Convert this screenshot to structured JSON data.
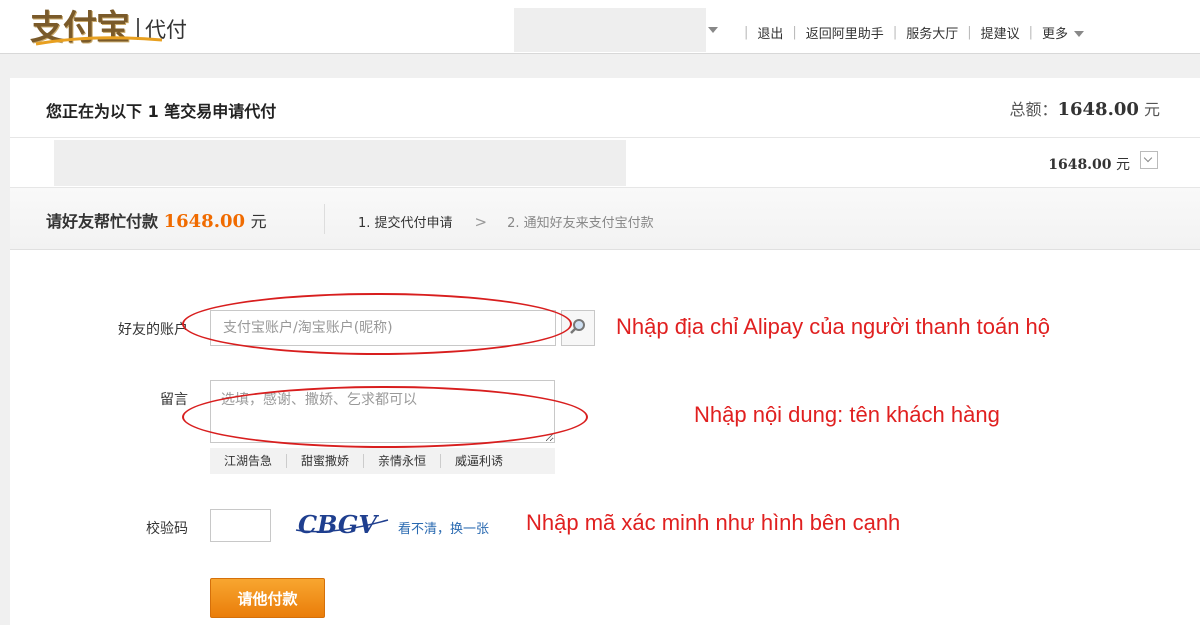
{
  "header": {
    "logo_main": "支付宝",
    "logo_sub": "代付",
    "nav": [
      {
        "label": "退出"
      },
      {
        "label": "返回阿里助手"
      },
      {
        "label": "服务大厅"
      },
      {
        "label": "提建议"
      },
      {
        "label": "更多"
      }
    ]
  },
  "trade": {
    "title": "您正在为以下 1 笔交易申请代付",
    "total_label": "总额：",
    "total_amount": "1648.00",
    "currency": "元",
    "item_amount": "1648.00"
  },
  "steps_bar": {
    "help_prefix": "请好友帮忙付款",
    "help_amount": "1648.00",
    "help_unit": "元",
    "step1": "1. 提交代付申请",
    "arrow": ">",
    "step2": "2. 通知好友来支付宝付款"
  },
  "form": {
    "account_label": "好友的账户",
    "account_placeholder": "支付宝账户/淘宝账户(昵称)",
    "message_label": "留言",
    "message_placeholder": "选填，感谢、撒娇、乞求都可以",
    "quick_tags": [
      "江湖告急",
      "甜蜜撒娇",
      "亲情永恒",
      "威逼利诱"
    ],
    "captcha_label": "校验码",
    "captcha_text": "CBGV",
    "refresh_link": "看不清，换一张",
    "submit_label": "请他付款"
  },
  "annotations": {
    "account": "Nhập địa chỉ Alipay của người thanh toán hộ",
    "message": "Nhập nội dung: tên khách hàng",
    "captcha": "Nhập mã xác minh như hình bên cạnh"
  },
  "colors": {
    "accent_orange": "#f06b00",
    "annotation_red": "#e02020",
    "link_blue": "#2a6ab1"
  }
}
